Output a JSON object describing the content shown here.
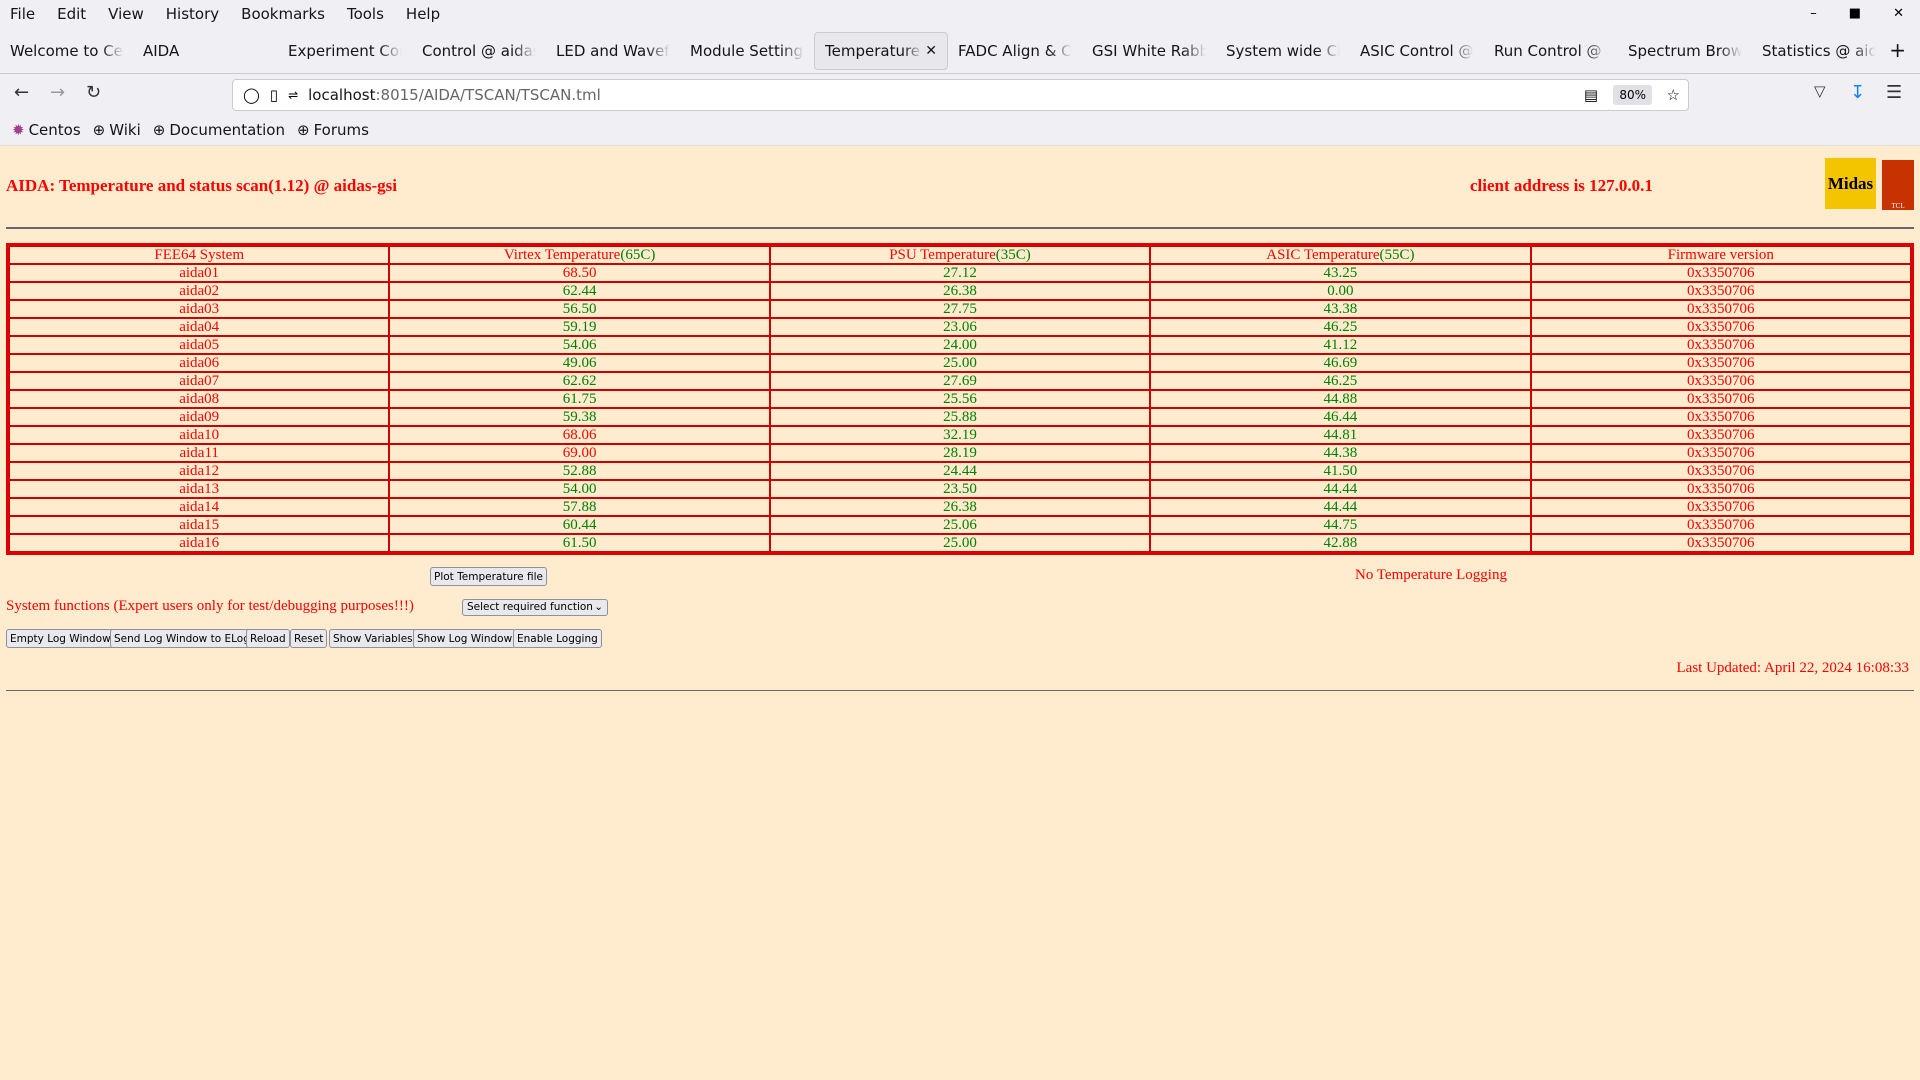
{
  "browser": {
    "menu": [
      "File",
      "Edit",
      "View",
      "History",
      "Bookmarks",
      "Tools",
      "Help"
    ],
    "tabs": [
      {
        "label": "Welcome to Centos"
      },
      {
        "label": "AIDA"
      },
      {
        "label": "Experiment Control"
      },
      {
        "label": "Control @ aidas-gsi"
      },
      {
        "label": "LED and Waveform"
      },
      {
        "label": "Module Settings"
      },
      {
        "label": "Temperature and status",
        "active": true
      },
      {
        "label": "FADC Align & Control"
      },
      {
        "label": "GSI White Rabbit"
      },
      {
        "label": "System wide Checks"
      },
      {
        "label": "ASIC Control @ aidas"
      },
      {
        "label": "Run Control @ aidas"
      },
      {
        "label": "Spectrum Browser"
      },
      {
        "label": "Statistics @ aidas"
      }
    ],
    "url_host": "localhost",
    "url_rest": ":8015/AIDA/TSCAN/TSCAN.tml",
    "zoom": "80%",
    "bookmarks": [
      {
        "label": "Centos",
        "icon": "centos-icon"
      },
      {
        "label": "Wiki",
        "icon": "globe-icon"
      },
      {
        "label": "Documentation",
        "icon": "globe-icon"
      },
      {
        "label": "Forums",
        "icon": "globe-icon"
      }
    ]
  },
  "page": {
    "title": "AIDA: Temperature and status scan(1.12) @ aidas-gsi",
    "client": "client address is 127.0.0.1",
    "logos": [
      "Midas",
      "TCL Powered"
    ],
    "headers": [
      {
        "text": "FEE64 System"
      },
      {
        "text": "Virtex Temperature",
        "limit": "(65C)"
      },
      {
        "text": "PSU Temperature",
        "limit": "(35C)"
      },
      {
        "text": "ASIC Temperature",
        "limit": "(55C)"
      },
      {
        "text": "Firmware version"
      }
    ],
    "colors": {
      "alarm": "#ff0000",
      "ok": "#008000",
      "background": "#ffebcd"
    },
    "rows": [
      [
        "aida01",
        "68.50",
        "27.12",
        "43.25",
        "0x3350706"
      ],
      [
        "aida02",
        "62.44",
        "26.38",
        "0.00",
        "0x3350706"
      ],
      [
        "aida03",
        "56.50",
        "27.75",
        "43.38",
        "0x3350706"
      ],
      [
        "aida04",
        "59.19",
        "23.06",
        "46.25",
        "0x3350706"
      ],
      [
        "aida05",
        "54.06",
        "24.00",
        "41.12",
        "0x3350706"
      ],
      [
        "aida06",
        "49.06",
        "25.00",
        "46.69",
        "0x3350706"
      ],
      [
        "aida07",
        "62.62",
        "27.69",
        "46.25",
        "0x3350706"
      ],
      [
        "aida08",
        "61.75",
        "25.56",
        "44.88",
        "0x3350706"
      ],
      [
        "aida09",
        "59.38",
        "25.88",
        "46.44",
        "0x3350706"
      ],
      [
        "aida10",
        "68.06",
        "32.19",
        "44.81",
        "0x3350706"
      ],
      [
        "aida11",
        "69.00",
        "28.19",
        "44.38",
        "0x3350706"
      ],
      [
        "aida12",
        "52.88",
        "24.44",
        "41.50",
        "0x3350706"
      ],
      [
        "aida13",
        "54.00",
        "23.50",
        "44.44",
        "0x3350706"
      ],
      [
        "aida14",
        "57.88",
        "26.38",
        "44.44",
        "0x3350706"
      ],
      [
        "aida15",
        "60.44",
        "25.06",
        "44.75",
        "0x3350706"
      ],
      [
        "aida16",
        "61.50",
        "25.00",
        "42.88",
        "0x3350706"
      ]
    ],
    "plot_button": "Plot Temperature file",
    "no_logging": "No Temperature Logging",
    "system_functions": "System functions (Expert users only for test/debugging purposes!!!)",
    "select_value": "Select required function",
    "buttons": [
      "Empty Log Window",
      "Send Log Window to ELog",
      "Reload",
      "Reset",
      "Show Variables",
      "Show Log Window",
      "Enable Logging"
    ],
    "last_updated": "Last Updated: April 22, 2024 16:08:33"
  }
}
